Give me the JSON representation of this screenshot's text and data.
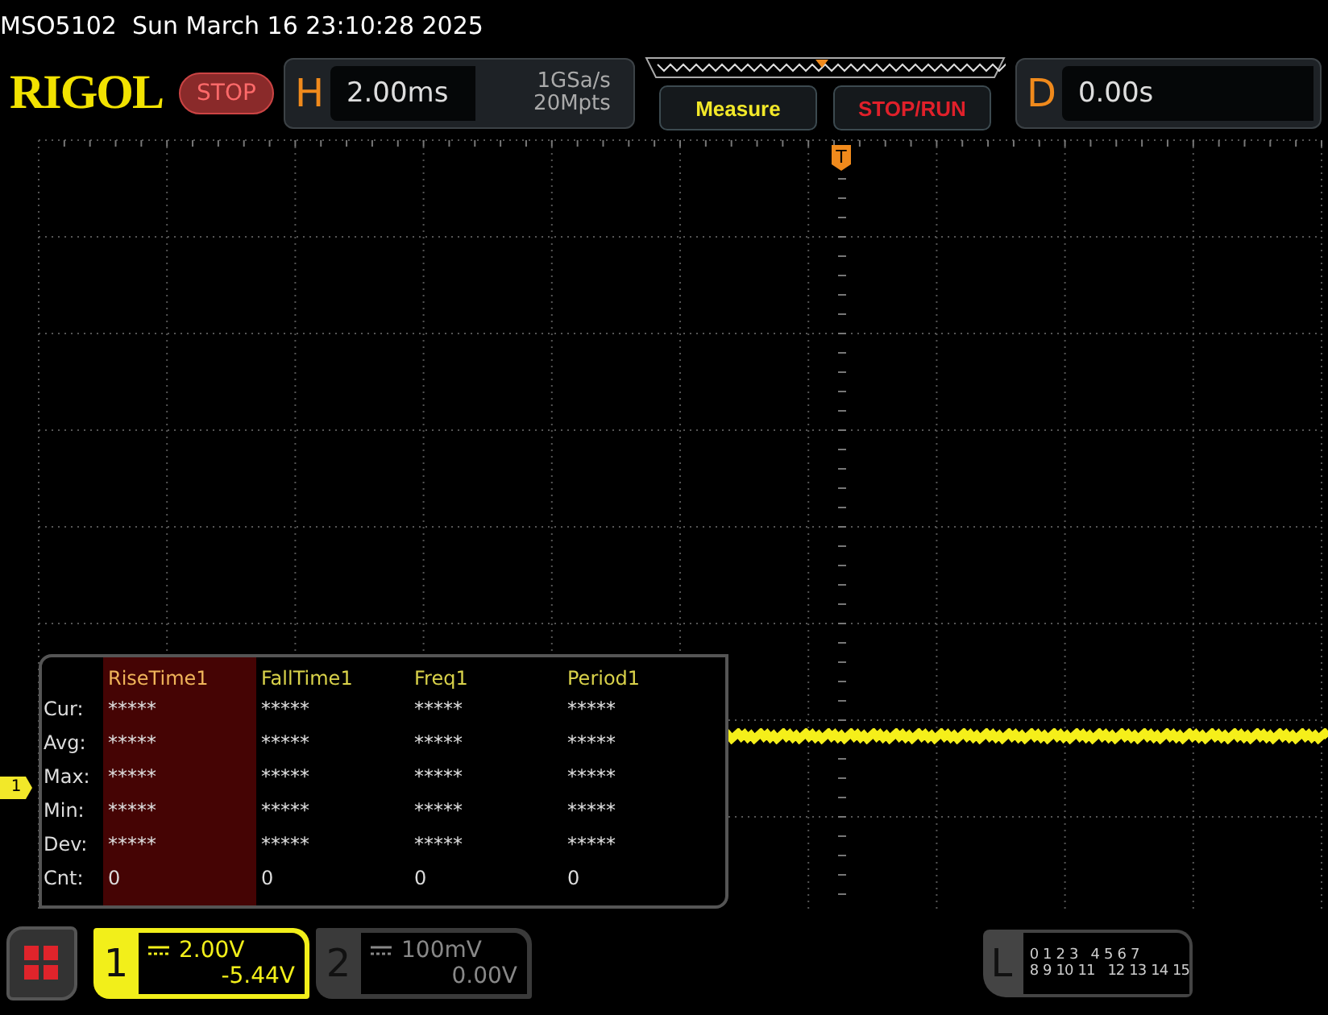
{
  "title": "MSO5102  Sun March 16 23:10:28 2025",
  "toolbar": {
    "logo": "RIGOL",
    "run_state": "STOP",
    "horizontal": {
      "label": "H",
      "scale": "2.00ms",
      "sample_rate": "1GSa/s",
      "memory_depth": "20Mpts"
    },
    "buttons": [
      {
        "label": "Measure",
        "color": "#f2e829"
      },
      {
        "label": "STOP/RUN",
        "color": "#e0202a"
      }
    ],
    "delay": {
      "label": "D",
      "value": "0.00s"
    }
  },
  "trigger_marker": "T",
  "channel_marker": "1",
  "measure_table": {
    "columns": [
      {
        "label": "RiseTime1",
        "selected": true
      },
      {
        "label": "FallTime1",
        "selected": false
      },
      {
        "label": "Freq1",
        "selected": false
      },
      {
        "label": "Period1",
        "selected": false
      }
    ],
    "rows": [
      {
        "label": "Cur:",
        "values": [
          "*****",
          "*****",
          "*****",
          "*****"
        ]
      },
      {
        "label": "Avg:",
        "values": [
          "*****",
          "*****",
          "*****",
          "*****"
        ]
      },
      {
        "label": "Max:",
        "values": [
          "*****",
          "*****",
          "*****",
          "*****"
        ]
      },
      {
        "label": "Min:",
        "values": [
          "*****",
          "*****",
          "*****",
          "*****"
        ]
      },
      {
        "label": "Dev:",
        "values": [
          "*****",
          "*****",
          "*****",
          "*****"
        ]
      },
      {
        "label": "Cnt:",
        "values": [
          "0",
          "0",
          "0",
          "0"
        ]
      }
    ]
  },
  "channels": [
    {
      "number": "1",
      "scale": "2.00V",
      "offset": "-5.44V",
      "active": true
    },
    {
      "number": "2",
      "scale": "100mV",
      "offset": "0.00V",
      "active": false
    }
  ],
  "logic": {
    "label": "L",
    "row_1": [
      "0",
      "1",
      "2",
      "3",
      "4",
      "5",
      "6",
      "7"
    ],
    "row_2": [
      "8",
      "9",
      "10",
      "11",
      "12",
      "13",
      "14",
      "15"
    ]
  }
}
